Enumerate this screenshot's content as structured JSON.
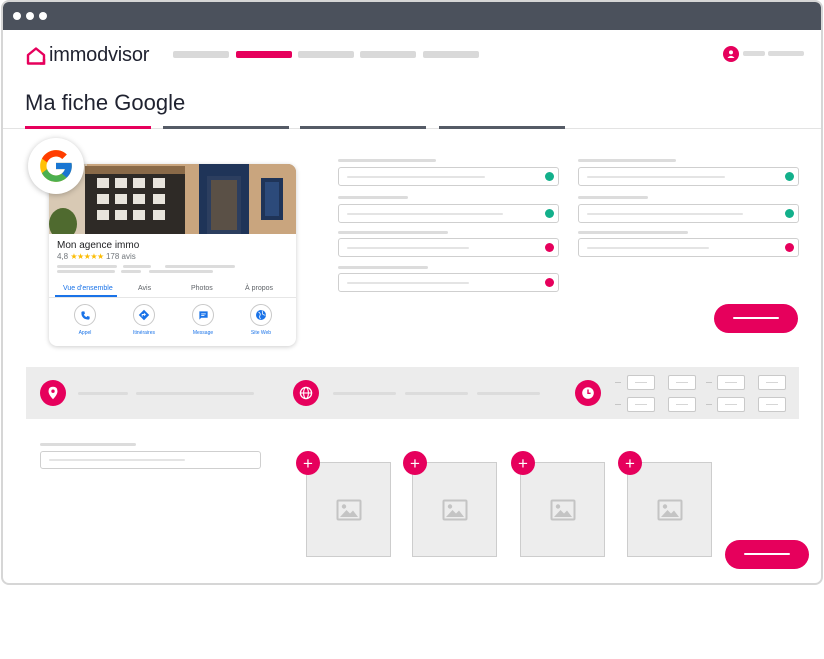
{
  "app": {
    "brand": "immodvisor",
    "accent_color": "#e6005c",
    "chrome_color": "#4b515c"
  },
  "page": {
    "title": "Ma fiche Google"
  },
  "google_card": {
    "agency_name": "Mon agence immo",
    "rating": "4,8",
    "stars": "★★★★★",
    "reviews": "178 avis",
    "tabs": [
      {
        "label": "Vue d'ensemble",
        "active": true
      },
      {
        "label": "Avis",
        "active": false
      },
      {
        "label": "Photos",
        "active": false
      },
      {
        "label": "À propos",
        "active": false
      }
    ],
    "actions": [
      {
        "label": "Appel",
        "icon": "phone-icon"
      },
      {
        "label": "Itinéraires",
        "icon": "directions-icon"
      },
      {
        "label": "Message",
        "icon": "message-icon"
      },
      {
        "label": "Site Web",
        "icon": "globe-icon"
      }
    ]
  },
  "form": {
    "fields": [
      {
        "status": "valid"
      },
      {
        "status": "valid"
      },
      {
        "status": "valid"
      },
      {
        "status": "valid"
      },
      {
        "status": "error"
      },
      {
        "status": "error"
      },
      {
        "status": "error"
      }
    ]
  },
  "info_band": {
    "icons": [
      "location-pin-icon",
      "globe-icon",
      "clock-icon"
    ]
  },
  "photos": {
    "tile_icon": "image-placeholder-icon",
    "add_label": "+"
  }
}
